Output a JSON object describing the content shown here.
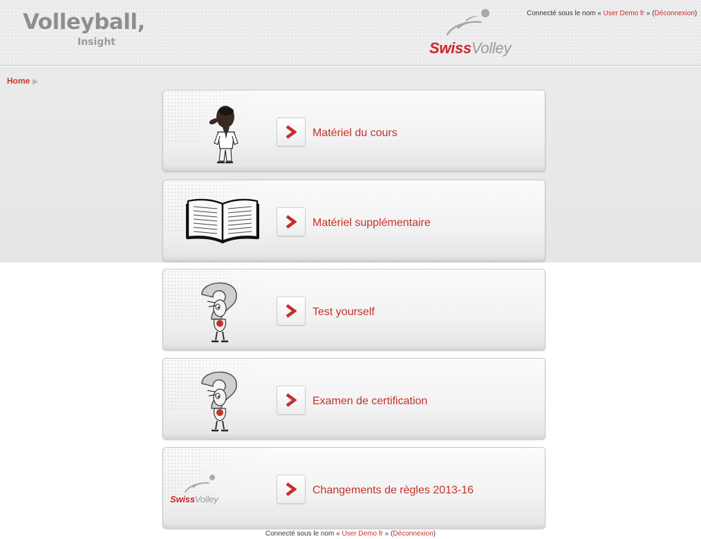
{
  "header": {
    "brand_title": "Volleyball,",
    "brand_subtitle": "Insight",
    "logo_text_primary": "Swiss",
    "logo_text_secondary": "Volley",
    "login_prefix": "Connecté sous le nom « ",
    "user_name": "User Demo fr",
    "login_mid": " » (",
    "logout_label": "Déconnexion",
    "login_suffix": ")"
  },
  "breadcrumb": {
    "home_label": "Home",
    "separator": "▶"
  },
  "cards": [
    {
      "label": "Matériel du cours",
      "icon": "teacher-icon"
    },
    {
      "label": "Matériel supplémentaire",
      "icon": "open-book-icon"
    },
    {
      "label": "Test yourself",
      "icon": "question-mark-character-icon"
    },
    {
      "label": "Examen de certification",
      "icon": "question-mark-character-icon"
    },
    {
      "label": "Changements de règles 2013-16",
      "icon": "swiss-volley-logo-icon"
    }
  ],
  "card_logo": {
    "primary": "Swiss",
    "secondary": "Volley"
  },
  "footer": {
    "login_prefix": "Connecté sous le nom « ",
    "user_name": "User Demo fr",
    "login_mid": " » (",
    "logout_label": "Déconnexion",
    "login_suffix": ")"
  },
  "colors": {
    "accent_red": "#c4302b",
    "brand_grey": "#8e8e8e",
    "header_bg": "#eeeeee"
  }
}
